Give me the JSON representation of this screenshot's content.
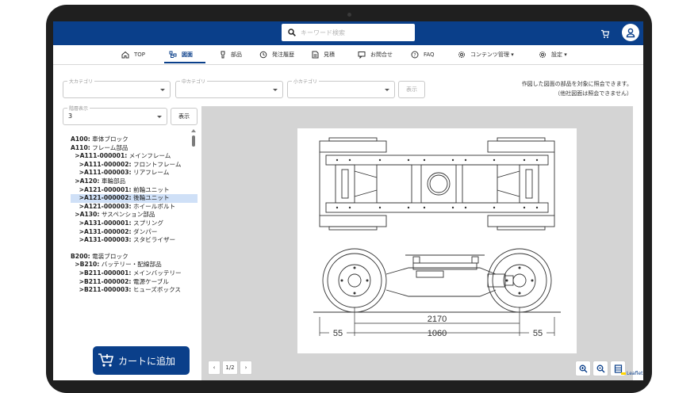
{
  "header": {
    "search_placeholder": "キーワード検索",
    "brand_color": "#0a3f8a"
  },
  "nav": {
    "items": [
      {
        "label": "TOP",
        "icon": "home-icon"
      },
      {
        "label": "図面",
        "icon": "diagram-icon",
        "active": true
      },
      {
        "label": "部品",
        "icon": "part-icon"
      },
      {
        "label": "発注履歴",
        "icon": "history-icon"
      },
      {
        "label": "見積",
        "icon": "document-icon"
      },
      {
        "label": "お問合せ",
        "icon": "chat-icon"
      },
      {
        "label": "FAQ",
        "icon": "help-icon"
      },
      {
        "label": "コンテンツ管理 ▾",
        "icon": "gear-icon"
      },
      {
        "label": "設定 ▾",
        "icon": "gear-icon"
      }
    ]
  },
  "filters": {
    "large_category_label": "大カテゴリ",
    "middle_category_label": "中カテゴリ",
    "small_category_label": "小カテゴリ",
    "show_button": "表示",
    "level_label": "階層表示",
    "level_value": "3",
    "level_show_button": "表示",
    "note_line1": "作図した図面の部品を対象に照会できます。",
    "note_line2": "（他社図面は照会できません）"
  },
  "tree": {
    "items": [
      {
        "code": "A100:",
        "name": " 車体ブロック"
      },
      {
        "code": "A110:",
        "name": " フレーム部品"
      },
      {
        "code": "  >A111-000001:",
        "name": " メインフレーム"
      },
      {
        "code": "    >A111-000002:",
        "name": " フロントフレーム"
      },
      {
        "code": "    >A111-000003:",
        "name": " リアフレーム"
      },
      {
        "code": "  >A120:",
        "name": " 車輪部品"
      },
      {
        "code": "    >A121-000001:",
        "name": " 前輪ユニット"
      },
      {
        "code": "    >A121-000002:",
        "name": " 後輪ユニット",
        "selected": true
      },
      {
        "code": "    >A121-000003:",
        "name": " ホイールボルト"
      },
      {
        "code": "  >A130:",
        "name": " サスペンション部品"
      },
      {
        "code": "    >A131-000001:",
        "name": " スプリング"
      },
      {
        "code": "    >A131-000002:",
        "name": " ダンパー"
      },
      {
        "code": "    >A131-000003:",
        "name": " スタビライザー"
      },
      {
        "code": "B200:",
        "name": " 電装ブロック",
        "gap_before": true
      },
      {
        "code": "  >B210:",
        "name": " バッテリー・配線部品"
      },
      {
        "code": "    >B211-000001:",
        "name": " メインバッテリー"
      },
      {
        "code": "    >B211-000002:",
        "name": " 電源ケーブル"
      },
      {
        "code": "    >B211-000003:",
        "name": " ヒューズボックス"
      }
    ]
  },
  "drawing": {
    "dim_wheelbase": "2170",
    "dim_inner": "1060",
    "dim_left": "55",
    "dim_right": "55"
  },
  "viewer": {
    "page_indicator": "1/2",
    "prev_label": "‹",
    "next_label": "›",
    "attribution": "Leaflet"
  },
  "cart_button": "カートに追加"
}
